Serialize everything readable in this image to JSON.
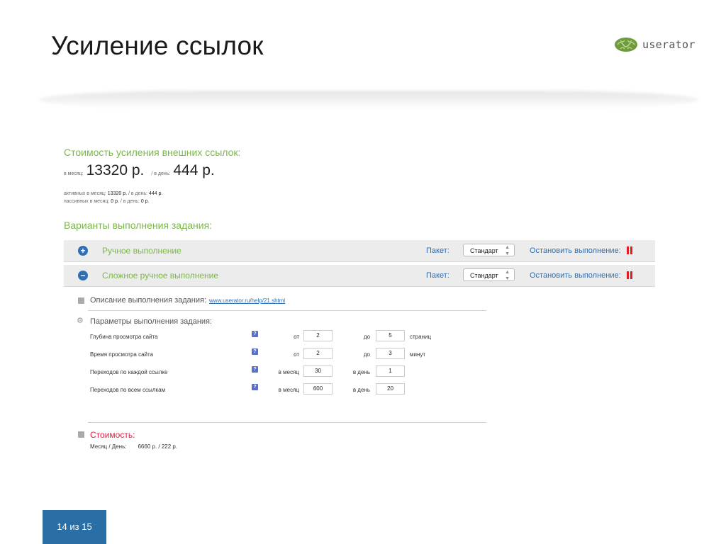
{
  "slide": {
    "title": "Усиление ссылок",
    "logo_text": "userator",
    "page_indicator": "14 из 15"
  },
  "cost": {
    "heading": "Стоимость усиления внешних ссылок:",
    "per_month_label": "в месяц:",
    "per_month_value": "13320 р.",
    "per_day_label": "/ в день:",
    "per_day_value": "444 р.",
    "active_line": {
      "label": "активных в месяц:",
      "month_value": "13320 р.",
      "sep": "/ в день:",
      "day_value": "444 р."
    },
    "passive_line": {
      "label": "пассивных в месяц:",
      "month_value": "0 р.",
      "sep": "/ в день:",
      "day_value": "0 р."
    }
  },
  "variants": {
    "heading": "Варианты выполнения задания:",
    "rows": [
      {
        "icon": "plus-circle-icon",
        "label": "Ручное выполнение",
        "package_label": "Пакет:",
        "package_value": "Стандарт",
        "stop_label": "Остановить выполнение:"
      },
      {
        "icon": "minus-circle-icon",
        "label": "Сложное ручное выполнение",
        "package_label": "Пакет:",
        "package_value": "Стандарт",
        "stop_label": "Остановить выполнение:"
      }
    ]
  },
  "details": {
    "description_title": "Описание выполнения задания:",
    "description_link": "www.userator.ru/help/21.shtml",
    "params_title": "Параметры выполнения задания:",
    "params": [
      {
        "label": "Глубина просмотра сайта",
        "from_label": "от",
        "from_value": "2",
        "to_label": "до",
        "to_value": "5",
        "unit": "страниц"
      },
      {
        "label": "Время просмотра сайта",
        "from_label": "от",
        "from_value": "2",
        "to_label": "до",
        "to_value": "3",
        "unit": "минут"
      },
      {
        "label": "Переходов по каждой ссылке",
        "from_label": "в месяц",
        "from_value": "30",
        "to_label": "в день",
        "to_value": "1",
        "unit": ""
      },
      {
        "label": "Переходов по всем ссылкам",
        "from_label": "в месяц",
        "from_value": "600",
        "to_label": "в день",
        "to_value": "20",
        "unit": ""
      }
    ],
    "help_icon_text": "?",
    "cost_title": "Стоимость:",
    "cost_line_label": "Месяц / День:",
    "cost_line_value": "6660 р. / 222 р."
  },
  "colors": {
    "accent_green": "#7ab847",
    "link_blue": "#2f6fb3",
    "stop_red": "#e02020",
    "cost_red": "#e0203b",
    "badge_blue": "#2a6ea6"
  }
}
